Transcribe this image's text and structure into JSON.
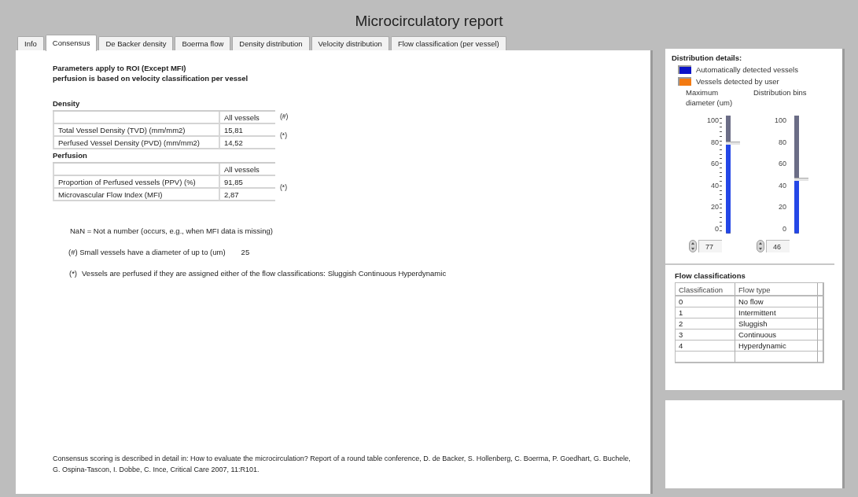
{
  "window": {
    "title": "Microcirculatory report"
  },
  "tabs": [
    {
      "label": "Info",
      "selected": false
    },
    {
      "label": "Consensus",
      "selected": true
    },
    {
      "label": "De Backer density",
      "selected": false
    },
    {
      "label": "Boerma flow",
      "selected": false
    },
    {
      "label": "Density distribution",
      "selected": false
    },
    {
      "label": "Velocity distribution",
      "selected": false
    },
    {
      "label": "Flow classification (per vessel)",
      "selected": false
    }
  ],
  "consensus": {
    "header_lines": [
      "Parameters apply to ROI (Except MFI)",
      "perfusion is based on velocity classification per vessel"
    ],
    "tables": [
      {
        "title": "Density",
        "column_header": "All vessels",
        "header_note": "(#)",
        "rows_note": "(*)",
        "rows": [
          {
            "label": "Total Vessel Density (TVD) (mm/mm2)",
            "value": "15,81"
          },
          {
            "label": "Perfused Vessel Density (PVD) (mm/mm2)",
            "value": "14,52"
          }
        ]
      },
      {
        "title": "Perfusion",
        "column_header": "All vessels",
        "rows_note": "(*)",
        "rows": [
          {
            "label": "Proportion of Perfused vessels (PPV) (%)",
            "value": "91,85"
          },
          {
            "label": "Microvascular Flow Index (MFI)",
            "value": "2,87"
          }
        ]
      }
    ],
    "nan_note": "NaN = Not a number (occurs, e.g., when MFI data is missing)",
    "small_vessels_note": {
      "text": "(#) Small vessels have a diameter of up to (um)",
      "value": "25"
    },
    "perfused_note": {
      "marker": "(*)",
      "text": "Vessels are perfused if they are assigned either of the flow classifications: Sluggish Continuous Hyperdynamic"
    },
    "reference": "Consensus scoring is described in detail in: How to evaluate the microcirculation? Report of a round table conference, D. de Backer, S. Hollenberg, C. Boerma, P. Goedhart, G. Buchele, G. Ospina-Tascon, I. Dobbe, C. Ince, Critical Care 2007, 11:R101."
  },
  "distribution_details": {
    "title": "Distribution details:",
    "legend": [
      {
        "label": "Automatically detected vessels",
        "color": "#0a12c8"
      },
      {
        "label": "Vessels detected by user",
        "color": "#f37a12"
      }
    ],
    "sliders": [
      {
        "label": "Maximum diameter (um)",
        "kind": "minor_ticks",
        "ticks": [
          "100",
          "80",
          "60",
          "40",
          "20",
          "0"
        ],
        "level": 0.77,
        "value": "77"
      },
      {
        "label": "Distribution bins",
        "kind": "plain",
        "ticks": [
          "100",
          "80",
          "60",
          "40",
          "20",
          "0"
        ],
        "level": 0.46,
        "value": "46"
      }
    ]
  },
  "flow_classifications": {
    "title": "Flow classifications",
    "columns": [
      "Classification",
      "Flow type"
    ],
    "rows": [
      [
        "0",
        "No flow"
      ],
      [
        "1",
        "Intermittent"
      ],
      [
        "2",
        "Sluggish"
      ],
      [
        "3",
        "Continuous"
      ],
      [
        "4",
        "Hyperdynamic"
      ]
    ]
  }
}
